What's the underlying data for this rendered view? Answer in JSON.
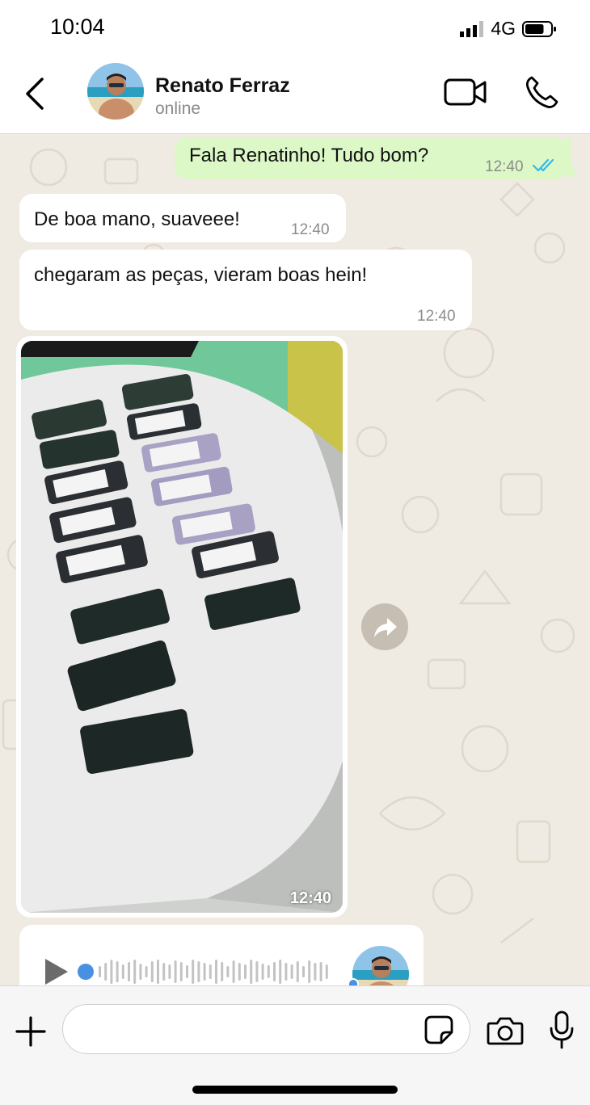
{
  "status_bar": {
    "time": "10:04",
    "network": "4G",
    "battery_level": 0.75,
    "signal_icon": "cellular-signal-icon",
    "battery_icon": "battery-icon"
  },
  "header": {
    "contact_name": "Renato Ferraz",
    "presence": "online",
    "back_icon": "chevron-left-icon",
    "video_icon": "video-camera-icon",
    "call_icon": "phone-icon"
  },
  "messages": [
    {
      "direction": "outgoing",
      "text": "Fala Renatinho! Tudo bom?",
      "time": "12:40",
      "status_icon": "double-check-read-icon"
    },
    {
      "direction": "incoming",
      "text": "De boa mano, suaveee!",
      "time": "12:40"
    },
    {
      "direction": "incoming",
      "text": "chegaram as peças, vieram boas hein!",
      "time": "12:40"
    },
    {
      "direction": "incoming",
      "type": "image",
      "time": "12:40",
      "forward_icon": "forward-share-icon"
    },
    {
      "direction": "incoming",
      "type": "audio",
      "play_icon": "play-icon"
    }
  ],
  "input_bar": {
    "placeholder": "",
    "attach_icon": "plus-icon",
    "sticker_icon": "sticker-icon",
    "camera_icon": "camera-icon",
    "mic_icon": "microphone-icon"
  },
  "colors": {
    "outgoing_bubble": "#dcf8c6",
    "incoming_bubble": "#ffffff",
    "wallpaper": "#efeae2",
    "read_ticks": "#34b7f1",
    "audio_accent": "#4a90e2"
  }
}
